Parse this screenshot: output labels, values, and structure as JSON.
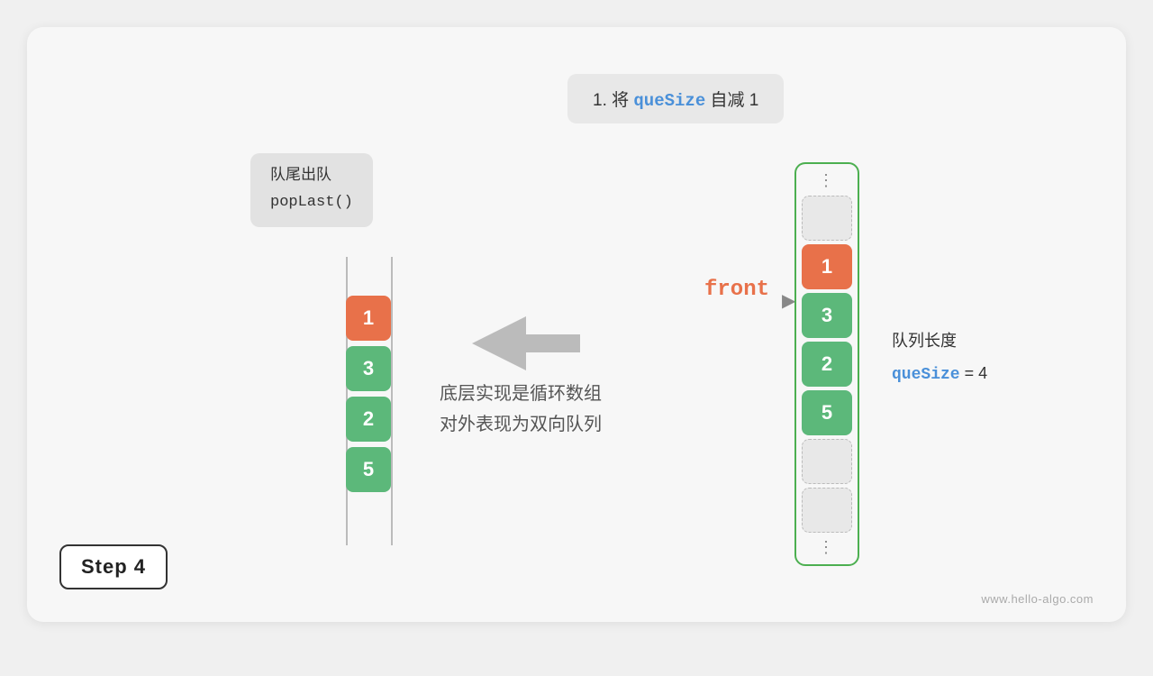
{
  "card": {
    "background": "#f7f7f7"
  },
  "step": {
    "label": "Step  4"
  },
  "watermark": {
    "text": "www.hello-algo.com"
  },
  "annotation": {
    "prefix": "1. 将 ",
    "keyword": "queSize",
    "suffix": " 自减 1"
  },
  "popup": {
    "line1": "队尾出队",
    "line2": "popLast()"
  },
  "middle_text": {
    "line1": "底层实现是循环数组",
    "line2": "对外表现为双向队列"
  },
  "left_stack": {
    "items": [
      {
        "value": "1",
        "color": "orange"
      },
      {
        "value": "3",
        "color": "green"
      },
      {
        "value": "2",
        "color": "green"
      },
      {
        "value": "5",
        "color": "green"
      }
    ]
  },
  "right_array": {
    "top_dots": "⋮",
    "bottom_dots": "⋮",
    "cells": [
      {
        "value": "",
        "type": "empty"
      },
      {
        "value": "1",
        "type": "orange"
      },
      {
        "value": "3",
        "type": "green"
      },
      {
        "value": "2",
        "type": "green"
      },
      {
        "value": "5",
        "type": "green"
      },
      {
        "value": "",
        "type": "empty"
      },
      {
        "value": "",
        "type": "empty"
      }
    ]
  },
  "front_label": {
    "text": "front"
  },
  "front_arrow": {
    "text": "▶"
  },
  "queue_info": {
    "label": "队列长度",
    "size_key": "queSize",
    "equals": " = 4"
  }
}
